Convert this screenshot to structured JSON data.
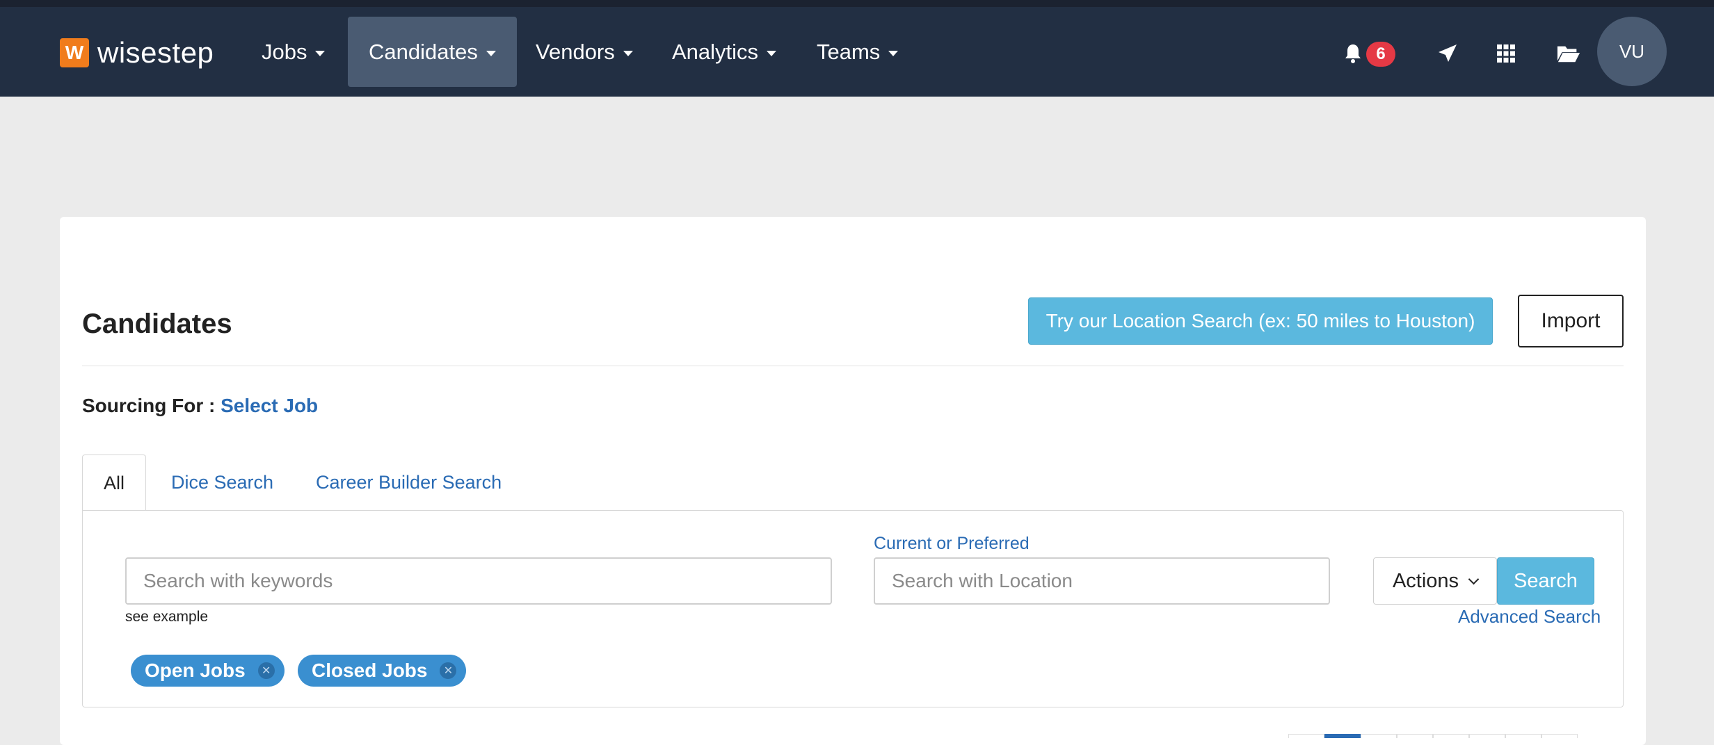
{
  "app": {
    "logo_letter": "W",
    "logo_text": "wisestep"
  },
  "nav": {
    "items": [
      {
        "label": "Jobs"
      },
      {
        "label": "Candidates",
        "active": true
      },
      {
        "label": "Vendors"
      },
      {
        "label": "Analytics"
      },
      {
        "label": "Teams"
      }
    ],
    "notification_count": "6",
    "avatar_initials": "VU"
  },
  "page": {
    "title": "Candidates",
    "location_search_button": "Try our Location Search (ex: 50 miles to Houston)",
    "import_button": "Import",
    "sourcing_label": "Sourcing For :",
    "sourcing_link": "Select Job"
  },
  "tabs": [
    {
      "label": "All",
      "active": true
    },
    {
      "label": "Dice Search"
    },
    {
      "label": "Career Builder Search"
    }
  ],
  "search": {
    "keywords_placeholder": "Search with keywords",
    "keywords_value": "",
    "see_example": "see example",
    "location_label": "Current or Preferred",
    "location_placeholder": "Search with Location",
    "location_value": "",
    "actions_label": "Actions",
    "search_button": "Search",
    "advanced_search": "Advanced Search"
  },
  "filters": [
    {
      "label": "Open Jobs"
    },
    {
      "label": "Closed Jobs"
    }
  ],
  "colors": {
    "navbar_bg": "#222f43",
    "nav_active_bg": "#4a5b72",
    "accent_button": "#5bb8de",
    "link": "#2a6bb4",
    "chip": "#3a8fd0",
    "badge": "#e53945",
    "logo": "#f07c1c"
  }
}
